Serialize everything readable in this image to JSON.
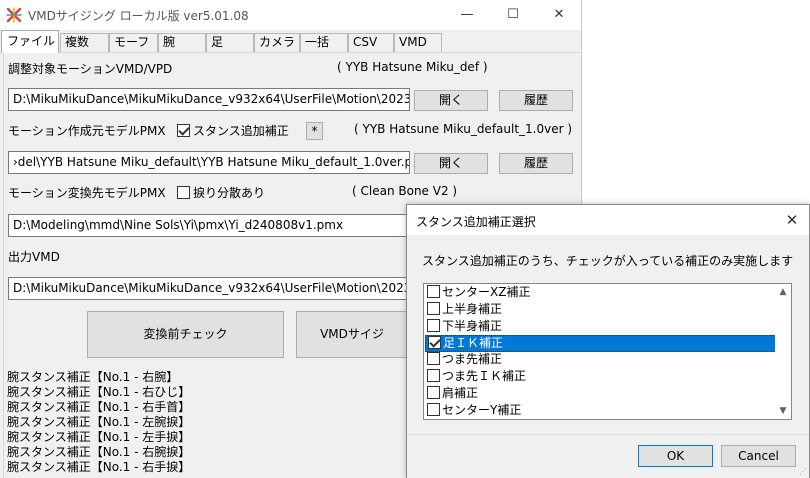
{
  "window": {
    "title": "VMDサイジング ローカル版 ver5.01.08",
    "min_glyph": "—",
    "max_glyph": "☐",
    "close_glyph": "✕"
  },
  "tabs": [
    {
      "label": "ファイル",
      "active": true
    },
    {
      "label": "複数"
    },
    {
      "label": "モーフ"
    },
    {
      "label": "腕"
    },
    {
      "label": "足"
    },
    {
      "label": "カメラ"
    },
    {
      "label": "一括"
    },
    {
      "label": "CSV"
    },
    {
      "label": "VMD"
    }
  ],
  "motion": {
    "label": "調整対象モーションVMD/VPD",
    "info": "( YYB Hatsune Miku_def )",
    "path": "D:\\MikuMikuDance\\MikuMikuDance_v932x64\\UserFile\\Motion\\2023_",
    "open_label": "開く",
    "history_label": "履歴"
  },
  "source_model": {
    "label": "モーション作成元モデルPMX",
    "checkbox_label": "スタンス追加補正",
    "checked": true,
    "star_label": "*",
    "info": "( YYB Hatsune Miku_default_1.0ver )",
    "path": "›del\\YYB Hatsune Miku_default\\YYB Hatsune Miku_default_1.0ver.pmx",
    "open_label": "開く",
    "history_label": "履歴"
  },
  "target_model": {
    "label": "モーション変換先モデルPMX",
    "checkbox_label": "捩り分散あり",
    "checked": false,
    "info": "( Clean Bone V2 )",
    "path": "D:\\Modeling\\mmd\\Nine Sols\\Yi\\pmx\\Yi_d240808v1.pmx"
  },
  "output": {
    "label": "出力VMD",
    "path": "D:\\MikuMikuDance\\MikuMikuDance_v932x64\\UserFile\\Motion\\2023_s"
  },
  "actions": {
    "precheck_label": "変換前チェック",
    "sizing_label": "VMDサイジ"
  },
  "log_lines": [
    "腕スタンス補正【No.1 - 右腕】",
    "腕スタンス補正【No.1 - 右ひじ】",
    "腕スタンス補正【No.1 - 右手首】",
    "腕スタンス補正【No.1 - 左腕捩】",
    "腕スタンス補正【No.1 - 左手捩】",
    "腕スタンス補正【No.1 - 右腕捩】",
    "腕スタンス補正【No.1 - 右手捩】"
  ],
  "dialog": {
    "title": "スタンス追加補正選択",
    "description": "スタンス追加補正のうち、チェックが入っている補正のみ実施します",
    "items": [
      {
        "label": "センターXZ補正",
        "checked": false,
        "selected": false
      },
      {
        "label": "上半身補正",
        "checked": false,
        "selected": false
      },
      {
        "label": "下半身補正",
        "checked": false,
        "selected": false
      },
      {
        "label": "足ＩＫ補正",
        "checked": true,
        "selected": true
      },
      {
        "label": "つま先補正",
        "checked": false,
        "selected": false
      },
      {
        "label": "つま先ＩＫ補正",
        "checked": false,
        "selected": false
      },
      {
        "label": "肩補正",
        "checked": false,
        "selected": false
      },
      {
        "label": "センターY補正",
        "checked": false,
        "selected": false
      }
    ],
    "ok_label": "OK",
    "cancel_label": "Cancel",
    "close_glyph": "✕",
    "scroll_up_glyph": "▲",
    "scroll_down_glyph": "▼"
  },
  "colors": {
    "selection": "#0078d7",
    "window_bg": "#f0f0f0"
  }
}
